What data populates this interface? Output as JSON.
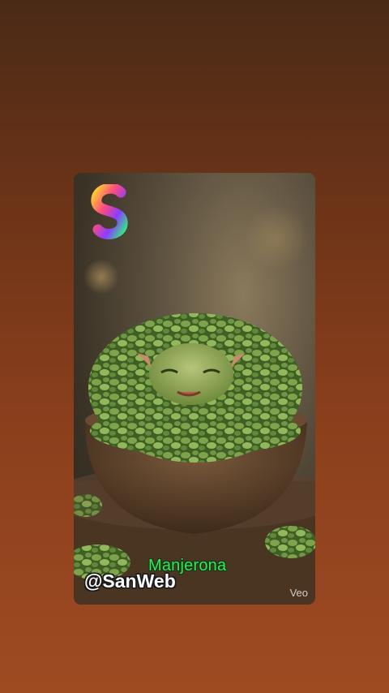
{
  "overlay": {
    "plant_name": "Manjerona",
    "handle": "@SanWeb",
    "watermark": "Veo"
  },
  "icons": {
    "app_logo": "gradient-s-logo-icon"
  },
  "colors": {
    "background_top": "#4a2a16",
    "background_bottom": "#9e4b22",
    "caption_green": "#3de25b",
    "leaf_green": "#5f8a3a"
  }
}
